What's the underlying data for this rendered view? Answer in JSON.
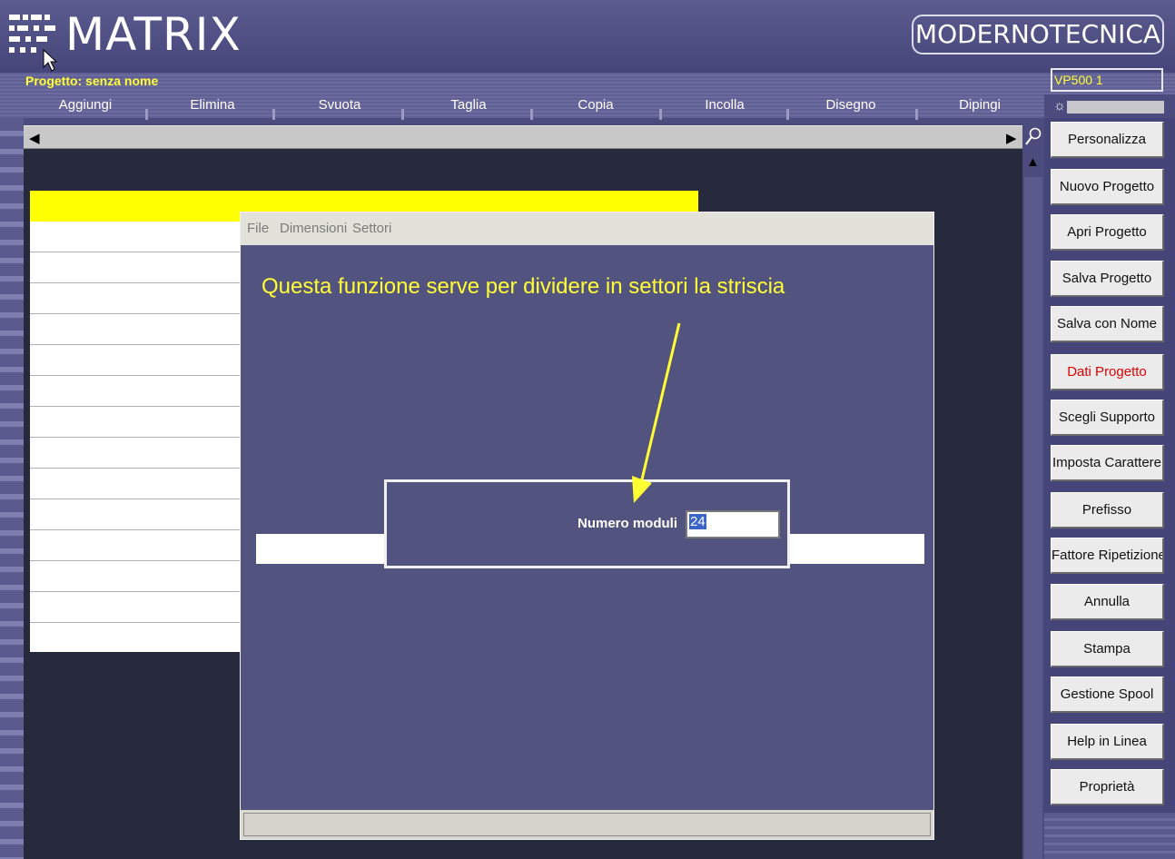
{
  "app": {
    "title": "MATRIX",
    "brand": "MODERNOTECNICA",
    "project_label": "Progetto: senza nome",
    "model": "VP500 1"
  },
  "toolbar": {
    "items": [
      "Aggiungi",
      "Elimina",
      "Svuota",
      "Taglia",
      "Copia",
      "Incolla",
      "Disegno",
      "Dipingi"
    ]
  },
  "icons": {
    "logo": "matrix-logo-icon",
    "sun": "sun-icon",
    "zoom": "magnifier-icon",
    "cursor": "mouse-pointer-icon"
  },
  "inner_window": {
    "menu": [
      "File",
      "Dimensioni",
      "Settori"
    ],
    "annotation": "Questa funzione serve per dividere in settori la striscia"
  },
  "dialog": {
    "label": "Numero moduli",
    "value": "24"
  },
  "sidebar": {
    "buttons": [
      {
        "label": "Personalizza",
        "color": "#111111"
      },
      {
        "label": "Nuovo Progetto",
        "color": "#111111"
      },
      {
        "label": "Apri Progetto",
        "color": "#111111"
      },
      {
        "label": "Salva Progetto",
        "color": "#111111"
      },
      {
        "label": "Salva con Nome",
        "color": "#111111"
      },
      {
        "label": "Dati Progetto",
        "color": "#e00000"
      },
      {
        "label": "Scegli Supporto",
        "color": "#111111"
      },
      {
        "label": "Imposta Carattere",
        "color": "#111111"
      },
      {
        "label": "Prefisso",
        "color": "#111111"
      },
      {
        "label": "Fattore Ripetizione",
        "color": "#111111"
      },
      {
        "label": "Annulla",
        "color": "#111111"
      },
      {
        "label": "Stampa",
        "color": "#111111"
      },
      {
        "label": "Gestione Spool",
        "color": "#111111"
      },
      {
        "label": "Help in Linea",
        "color": "#111111"
      },
      {
        "label": "Proprietà",
        "color": "#111111"
      }
    ]
  },
  "colors": {
    "accent_yellow": "#ffff33",
    "background": "#4b4b7e",
    "panel": "#535380"
  }
}
